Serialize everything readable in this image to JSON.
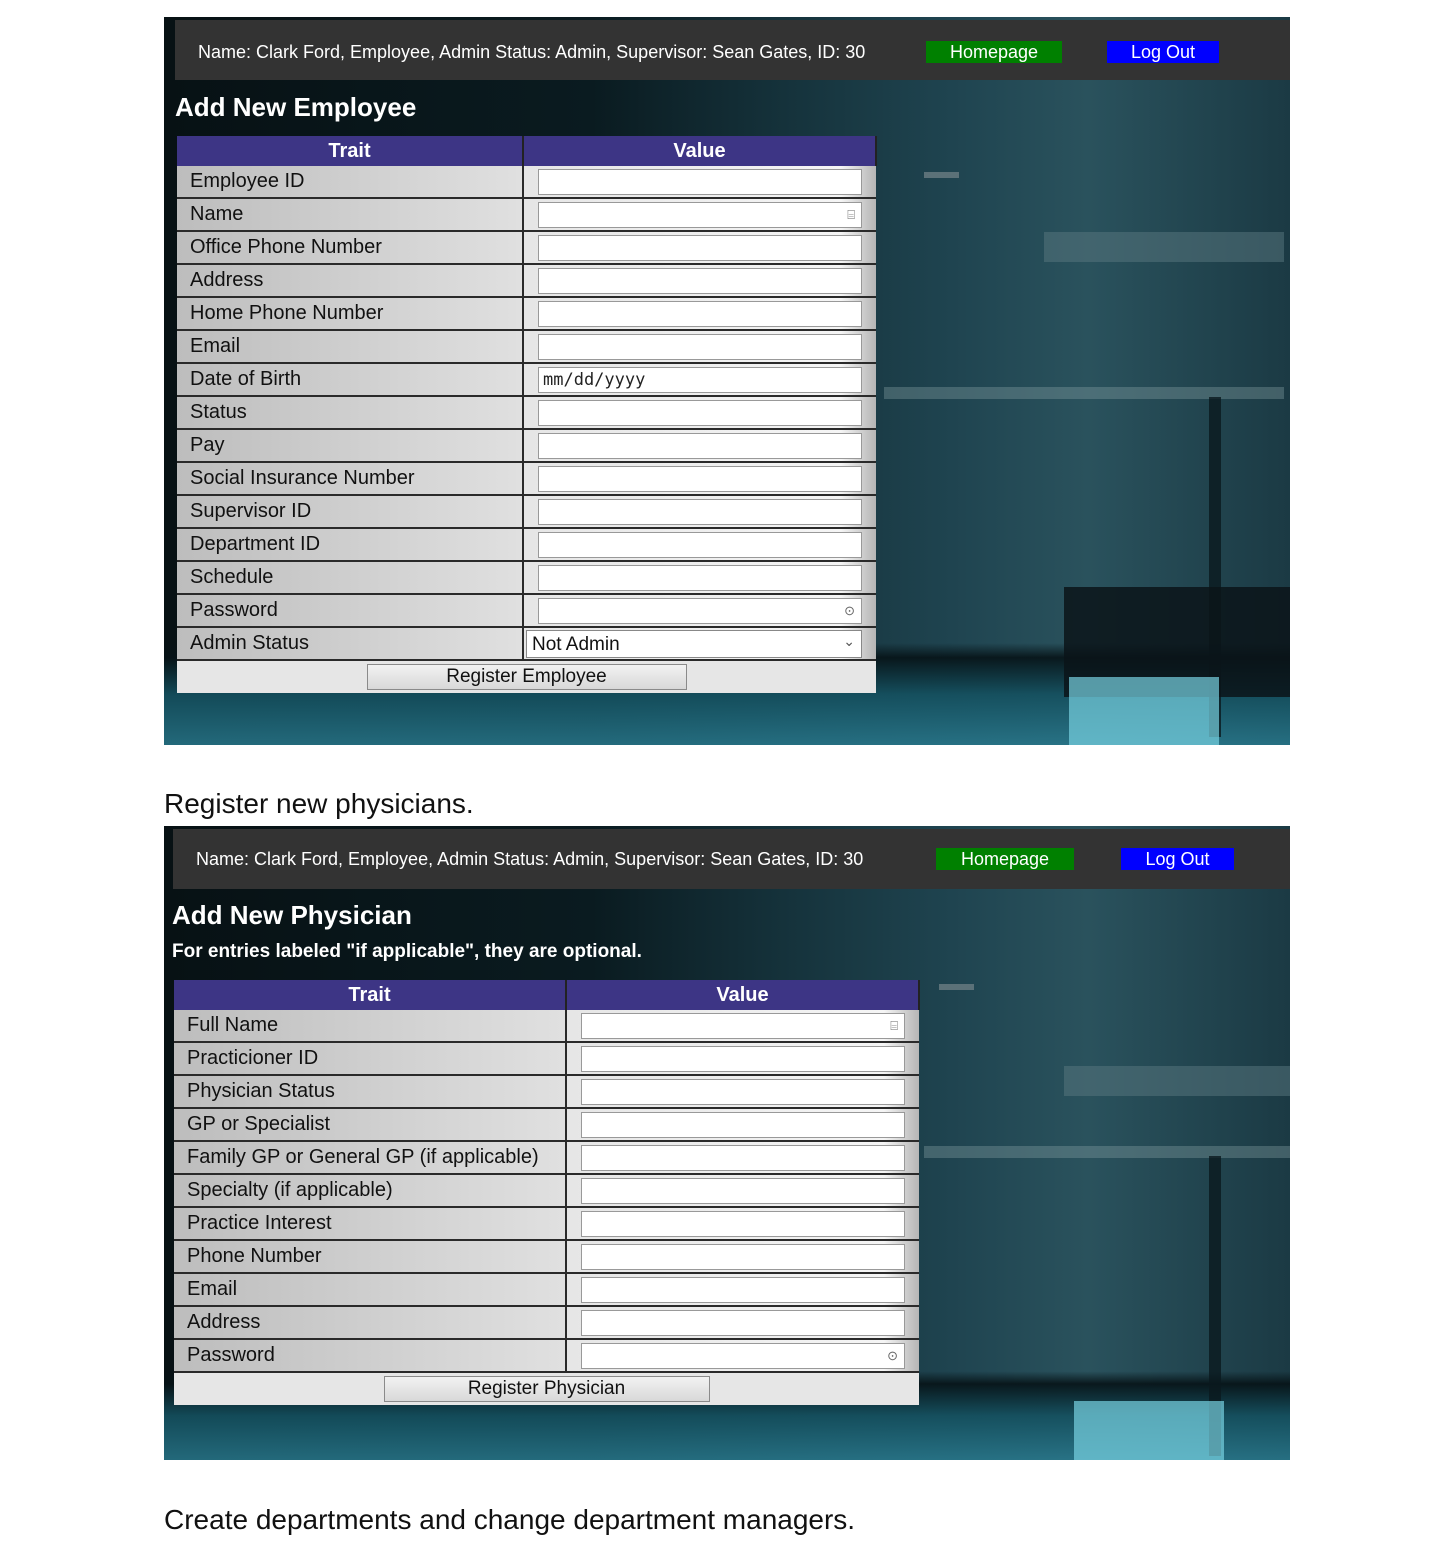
{
  "employee_panel": {
    "user_info": "Name: Clark Ford, Employee, Admin Status: Admin, Supervisor: Sean Gates, ID: 30",
    "homepage_label": "Homepage",
    "logout_label": "Log Out",
    "title": "Add New Employee",
    "header_trait": "Trait",
    "header_value": "Value",
    "rows": [
      {
        "label": "Employee ID",
        "kind": "text"
      },
      {
        "label": "Name",
        "kind": "text",
        "icon": "contact-card-icon"
      },
      {
        "label": "Office Phone Number",
        "kind": "text"
      },
      {
        "label": "Address",
        "kind": "text"
      },
      {
        "label": "Home Phone Number",
        "kind": "text"
      },
      {
        "label": "Email",
        "kind": "text"
      },
      {
        "label": "Date of Birth",
        "kind": "date",
        "placeholder": "mm/dd/yyyy"
      },
      {
        "label": "Status",
        "kind": "text"
      },
      {
        "label": "Pay",
        "kind": "text"
      },
      {
        "label": "Social Insurance Number",
        "kind": "text"
      },
      {
        "label": "Supervisor ID",
        "kind": "text"
      },
      {
        "label": "Department ID",
        "kind": "text"
      },
      {
        "label": "Schedule",
        "kind": "text"
      },
      {
        "label": "Password",
        "kind": "password",
        "icon": "key-icon"
      },
      {
        "label": "Admin Status",
        "kind": "select",
        "selected": "Not Admin"
      }
    ],
    "submit_label": "Register Employee"
  },
  "caption_1": "Register new physicians.",
  "physician_panel": {
    "user_info": "Name: Clark Ford, Employee, Admin Status: Admin, Supervisor: Sean Gates, ID: 30",
    "homepage_label": "Homepage",
    "logout_label": "Log Out",
    "title": "Add New Physician",
    "note": "For entries labeled \"if applicable\", they are optional.",
    "header_trait": "Trait",
    "header_value": "Value",
    "rows": [
      {
        "label": "Full Name",
        "kind": "text",
        "icon": "contact-card-icon"
      },
      {
        "label": "Practicioner ID",
        "kind": "text"
      },
      {
        "label": "Physician Status",
        "kind": "text"
      },
      {
        "label": "GP or Specialist",
        "kind": "text"
      },
      {
        "label": "Family GP or General GP (if applicable)",
        "kind": "text"
      },
      {
        "label": "Specialty (if applicable)",
        "kind": "text"
      },
      {
        "label": "Practice Interest",
        "kind": "text"
      },
      {
        "label": "Phone Number",
        "kind": "text"
      },
      {
        "label": "Email",
        "kind": "text"
      },
      {
        "label": "Address",
        "kind": "text"
      },
      {
        "label": "Password",
        "kind": "password",
        "icon": "key-icon"
      }
    ],
    "submit_label": "Register Physician"
  },
  "caption_2": "Create departments and change department managers.",
  "colors": {
    "header_bar": "#333333",
    "homepage_button": "#008000",
    "logout_button": "#0000ff",
    "table_header": "#3d3585"
  }
}
